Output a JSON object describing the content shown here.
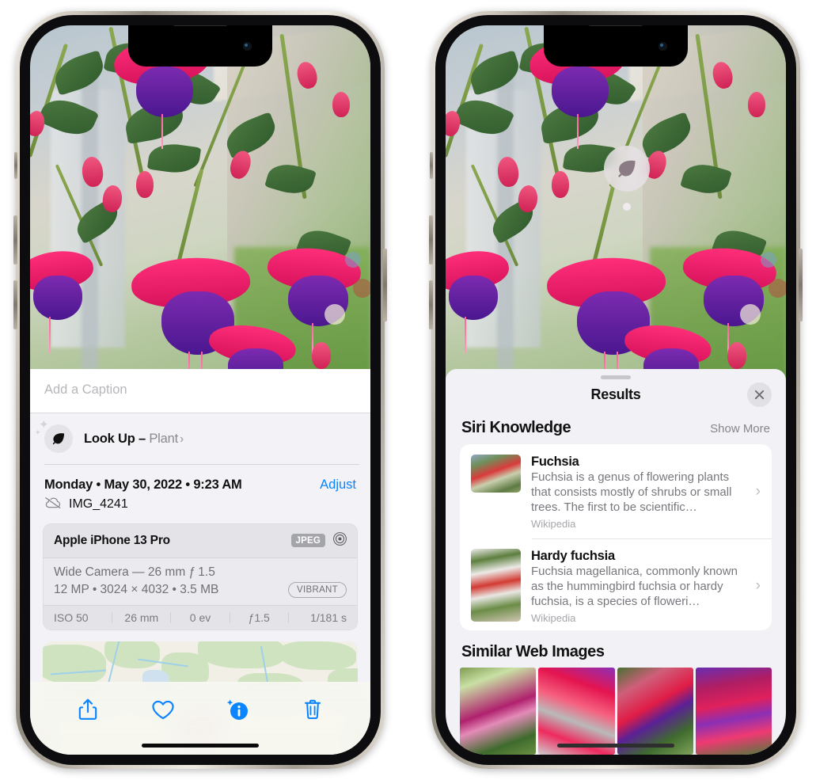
{
  "left_phone": {
    "caption": {
      "placeholder": "Add a Caption",
      "value": ""
    },
    "lookup": {
      "icon": "leaf-icon",
      "sparkle_icon": "sparkle-icon",
      "label": "Look Up – ",
      "subject": "Plant",
      "chevron": "›"
    },
    "date_row": {
      "date": "Monday • May 30, 2022 • 9:23 AM",
      "adjust_label": "Adjust"
    },
    "file_row": {
      "icon": "cloud-slash-icon",
      "filename": "IMG_4241"
    },
    "metadata": {
      "device": "Apple iPhone 13 Pro",
      "format_tag": "JPEG",
      "aperture_icon": "aperture-icon",
      "lens": "Wide Camera — 26 mm ƒ 1.5",
      "specs": "12 MP • 3024 × 4032 • 3.5 MB",
      "profile_tag": "VIBRANT",
      "exif": [
        "ISO 50",
        "26 mm",
        "0 ev",
        "ƒ1.5",
        "1/181 s"
      ]
    },
    "map": {
      "name": "location-map",
      "pin": "photo-thumbnail-pin"
    },
    "toolbar": [
      {
        "name": "share-button",
        "icon": "share-icon"
      },
      {
        "name": "favorite-button",
        "icon": "heart-icon"
      },
      {
        "name": "info-button",
        "icon": "info-sparkle-icon"
      },
      {
        "name": "delete-button",
        "icon": "trash-icon"
      }
    ],
    "accent_color": "#0a84ff"
  },
  "right_phone": {
    "visual_lookup_marker": {
      "icon": "leaf-icon",
      "name": "visual-lookup-marker"
    },
    "sheet": {
      "grabber": "drag-handle",
      "title": "Results",
      "close_icon": "close-icon"
    },
    "siri_knowledge": {
      "section_title": "Siri Knowledge",
      "show_more": "Show More",
      "items": [
        {
          "title": "Fuchsia",
          "description": "Fuchsia is a genus of flowering plants that consists mostly of shrubs or small trees. The first to be scientific…",
          "source": "Wikipedia",
          "thumb": "fuchsia-thumbnail"
        },
        {
          "title": "Hardy fuchsia",
          "description": "Fuchsia magellanica, commonly known as the hummingbird fuchsia or hardy fuchsia, is a species of floweri…",
          "source": "Wikipedia",
          "thumb": "hardy-fuchsia-thumbnail"
        }
      ]
    },
    "similar_web_images": {
      "section_title": "Similar Web Images",
      "images": [
        {
          "name": "web-image-1"
        },
        {
          "name": "web-image-2"
        },
        {
          "name": "web-image-3"
        },
        {
          "name": "web-image-4"
        }
      ]
    }
  }
}
